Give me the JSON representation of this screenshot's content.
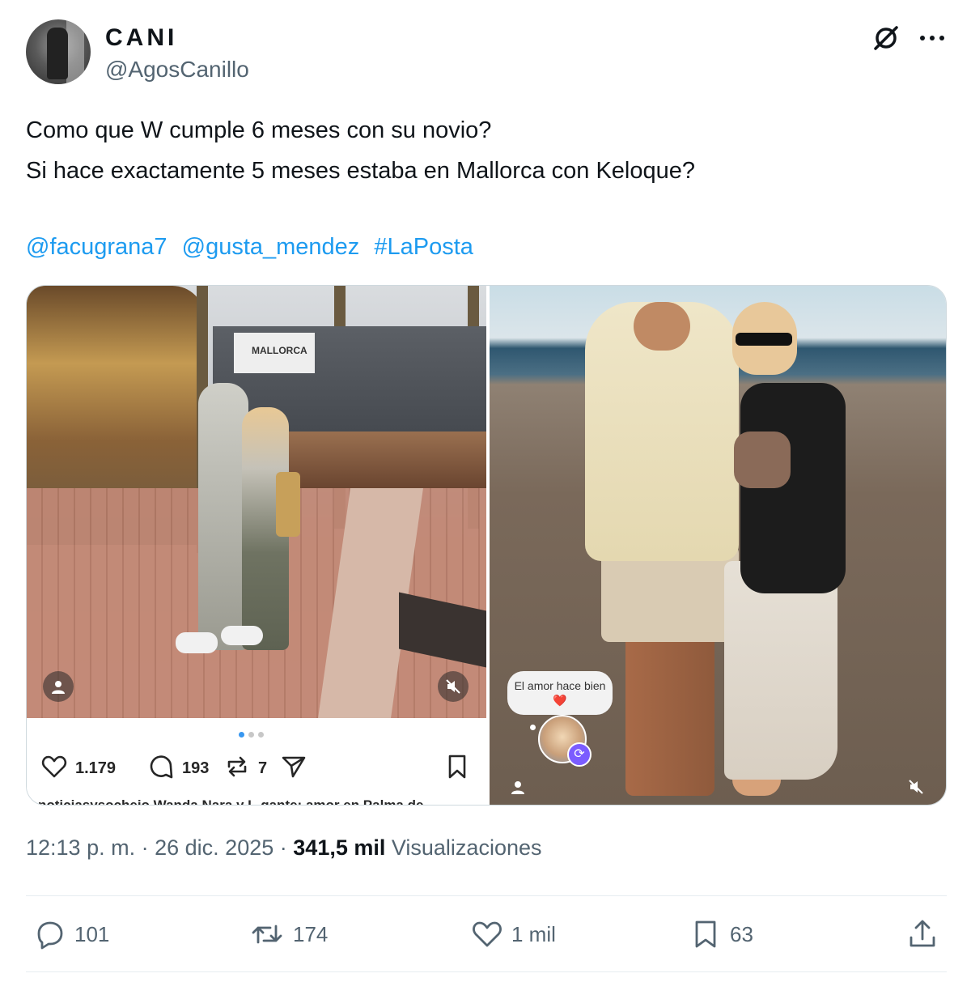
{
  "author": {
    "display_name": "CANI",
    "handle": "@AgosCanillo"
  },
  "tweet": {
    "lines": [
      "Como que W cumple 6 meses con su novio?",
      "Si hace exactamente 5 meses estaba en Mallorca con Keloque?"
    ],
    "mentions": [
      "@facugrana7",
      "@gusta_mendez",
      "#LaPosta"
    ]
  },
  "media": {
    "left_post": {
      "photo_sign_text": "MALLORCA",
      "likes": "1.179",
      "comments": "193",
      "reposts": "7",
      "caption": "noticiasysocheio Wanda Nara y L-gante: amor en Palma de"
    },
    "right_post": {
      "bubble_text": "El amor hace bien",
      "bubble_emoji": "❤️"
    }
  },
  "meta": {
    "time": "12:13 p. m.",
    "separator": "·",
    "date": "26 dic. 2025",
    "views_count": "341,5 mil",
    "views_label": "Visualizaciones"
  },
  "actions": {
    "replies": "101",
    "reposts": "174",
    "likes": "1 mil",
    "bookmarks": "63"
  },
  "colors": {
    "link": "#1d9bf0",
    "secondary_text": "#536471",
    "primary_text": "#0f1419"
  }
}
